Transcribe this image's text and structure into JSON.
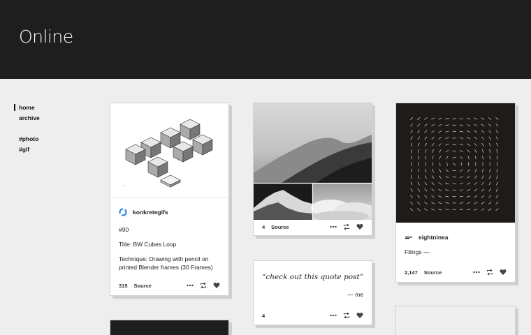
{
  "blog": {
    "title": "Online"
  },
  "nav": {
    "home": "home",
    "archive": "archive",
    "tag_photo": "#photo",
    "tag_gif": "#gif"
  },
  "posts": [
    {
      "type": "gif",
      "author": "konkretegifs",
      "lines": [
        "#90",
        "Title: BW Cubes Loop",
        "Technique: Drawing with pencil on printed Blender frames (30 Frames)"
      ],
      "notes": "315",
      "source_label": "Source"
    },
    {
      "type": "photoset",
      "notes": "4",
      "source_label": "Source"
    },
    {
      "type": "gif",
      "author": "eightninea",
      "lines": [
        "Filings —"
      ],
      "notes": "2,147",
      "source_label": "Source"
    },
    {
      "type": "quote",
      "quote": "“check out this quote post”",
      "attribution": "— me",
      "notes": "4"
    }
  ],
  "colors": {
    "header_bg": "#1e1e1e",
    "page_bg": "#eeeeee",
    "card_bg": "#ffffff",
    "card_shadow": "#cfcfcf"
  },
  "icons": [
    "more-icon",
    "reblog-icon",
    "heart-icon"
  ]
}
